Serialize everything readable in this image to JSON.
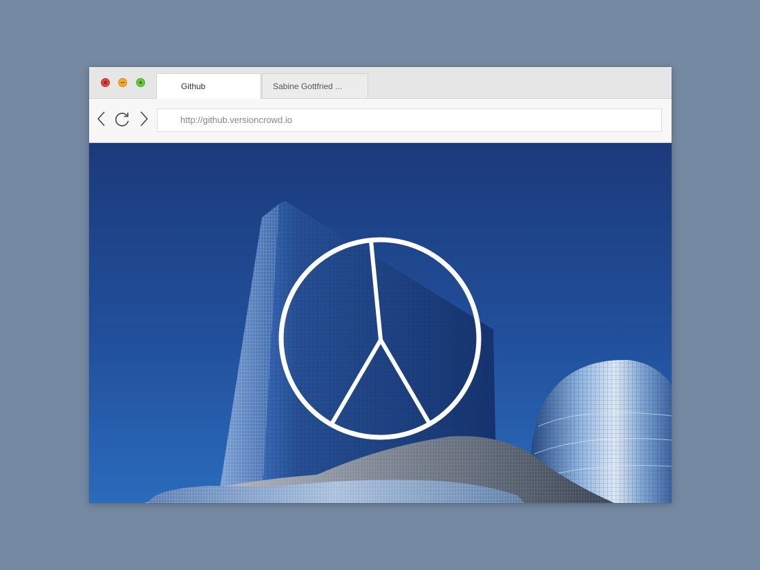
{
  "window": {
    "controls": {
      "close_icon": "close-icon",
      "minimize_icon": "minimize-icon",
      "maximize_icon": "maximize-icon"
    },
    "tabs": [
      {
        "label": "Github",
        "active": true
      },
      {
        "label": "Sabine Gottfried ...",
        "active": false
      }
    ]
  },
  "toolbar": {
    "back_icon": "back-arrow-icon",
    "reload_icon": "reload-icon",
    "forward_icon": "forward-arrow-icon",
    "address": "http://github.versioncrowd.io"
  },
  "content": {
    "background": "photo-skyscrapers-blue-sky",
    "overlay_icon": "peace-symbol-icon"
  },
  "colors": {
    "desktop": "#7589a3",
    "sky_top": "#1b3a7a",
    "sky_bottom": "#2a68b8",
    "close": "#e0443e",
    "minimize": "#f0a72a",
    "maximize": "#6cc63a"
  }
}
